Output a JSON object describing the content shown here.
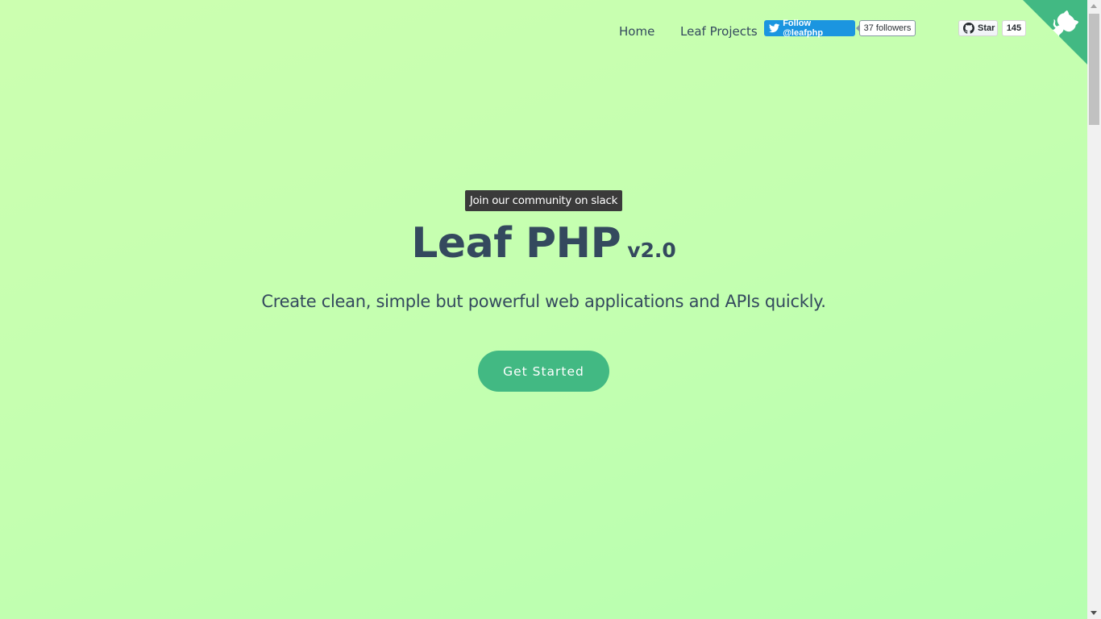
{
  "nav": {
    "home_label": "Home",
    "projects_label": "Leaf Projects",
    "twitter_follow_label": "Follow @leafphp",
    "twitter_followers": "37 followers",
    "github_star_label": "Star",
    "github_star_count": "145",
    "corner_icon": "github-octocat-icon"
  },
  "hero": {
    "slack_badge": "Join our community on slack",
    "title": "Leaf PHP",
    "version": "v2.0",
    "tagline": "Create clean, simple but powerful web applications and APIs quickly.",
    "cta_label": "Get Started"
  },
  "colors": {
    "accent": "#42b983",
    "text": "#34495e",
    "background": "#c4ffb0",
    "twitter": "#1b95e0",
    "badge": "#3a3a3a"
  }
}
